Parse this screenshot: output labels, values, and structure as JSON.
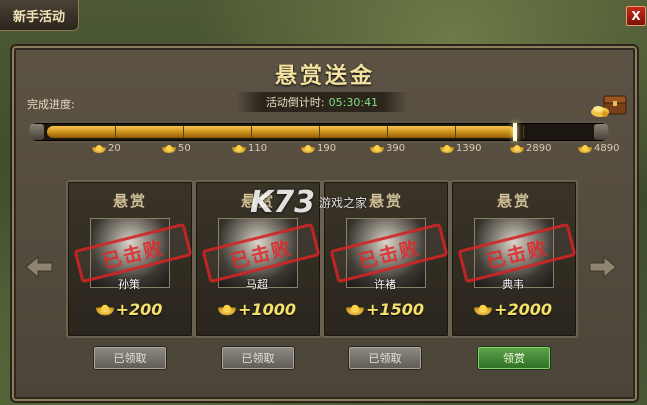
{
  "window": {
    "title": "新手活动",
    "close_label": "X"
  },
  "header": {
    "title": "悬赏送金",
    "progress_label": "完成进度:",
    "countdown_label": "活动倒计时:",
    "countdown_time": "05:30:41"
  },
  "progress": {
    "fill_fraction": 0.86,
    "milestones": [
      "20",
      "50",
      "110",
      "190",
      "390",
      "1390",
      "2890",
      "4890"
    ]
  },
  "cards": [
    {
      "title": "悬赏",
      "stamp": "已击败",
      "hero": "孙策",
      "reward": "+200",
      "button": "已领取",
      "claimed": true
    },
    {
      "title": "悬赏",
      "stamp": "已击败",
      "hero": "马超",
      "reward": "+1000",
      "button": "已领取",
      "claimed": true
    },
    {
      "title": "悬赏",
      "stamp": "已击败",
      "hero": "许褚",
      "reward": "+1500",
      "button": "已领取",
      "claimed": true
    },
    {
      "title": "悬赏",
      "stamp": "已击败",
      "hero": "典韦",
      "reward": "+2000",
      "button": "领赏",
      "claimed": false
    }
  ],
  "watermark": {
    "logo": "K73",
    "site": "游戏之家"
  },
  "icons": {
    "left_arrow": "arrow-left-icon",
    "right_arrow": "arrow-right-icon",
    "currency": "gold-ingot-icon",
    "treasure": "treasure-chest-icon"
  }
}
